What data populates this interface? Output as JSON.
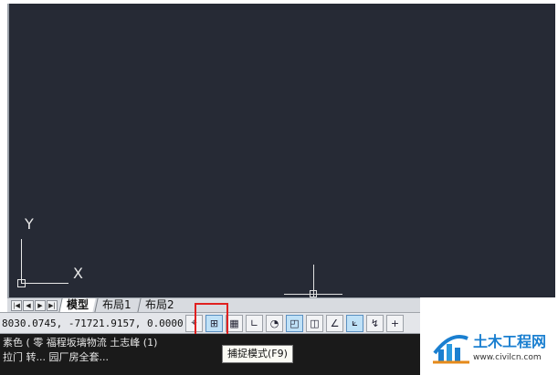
{
  "canvas": {
    "background": "#262a35",
    "ucs": {
      "y_label": "Y",
      "x_label": "X"
    }
  },
  "tabs": {
    "nav": [
      "|◀",
      "◀",
      "▶",
      "▶|"
    ],
    "items": [
      {
        "label": "模型",
        "active": true
      },
      {
        "label": "布局1",
        "active": false
      },
      {
        "label": "布局2",
        "active": false
      }
    ]
  },
  "statusbar": {
    "coordinates": "8030.0745,  -71721.9157, 0.0000",
    "buttons": [
      {
        "name": "infer-constraints",
        "glyph": "⌖",
        "on": false
      },
      {
        "name": "snap-mode",
        "glyph": "⊞",
        "on": true
      },
      {
        "name": "grid-display",
        "glyph": "▦",
        "on": false
      },
      {
        "name": "ortho-mode",
        "glyph": "∟",
        "on": false
      },
      {
        "name": "polar-tracking",
        "glyph": "◔",
        "on": false
      },
      {
        "name": "object-snap",
        "glyph": "◰",
        "on": true
      },
      {
        "name": "3d-object-snap",
        "glyph": "◫",
        "on": false
      },
      {
        "name": "object-snap-tracking",
        "glyph": "∠",
        "on": false
      },
      {
        "name": "dynamic-ucs",
        "glyph": "⟀",
        "on": true
      },
      {
        "name": "dynamic-input",
        "glyph": "↯",
        "on": false
      },
      {
        "name": "lineweight",
        "glyph": "+",
        "on": false
      }
    ]
  },
  "tooltip": {
    "text": "捕捉模式(F9)"
  },
  "command": {
    "lines": [
      "素色 ( 零 福程坂璃物流   土志峰 (1)",
      "拉门 转... 园厂房全套..."
    ]
  },
  "watermark": {
    "title": "土木工程网",
    "url": "www.civilcn.com"
  },
  "colors": {
    "highlight": "#e02020",
    "brand": "#1a7fd0"
  }
}
